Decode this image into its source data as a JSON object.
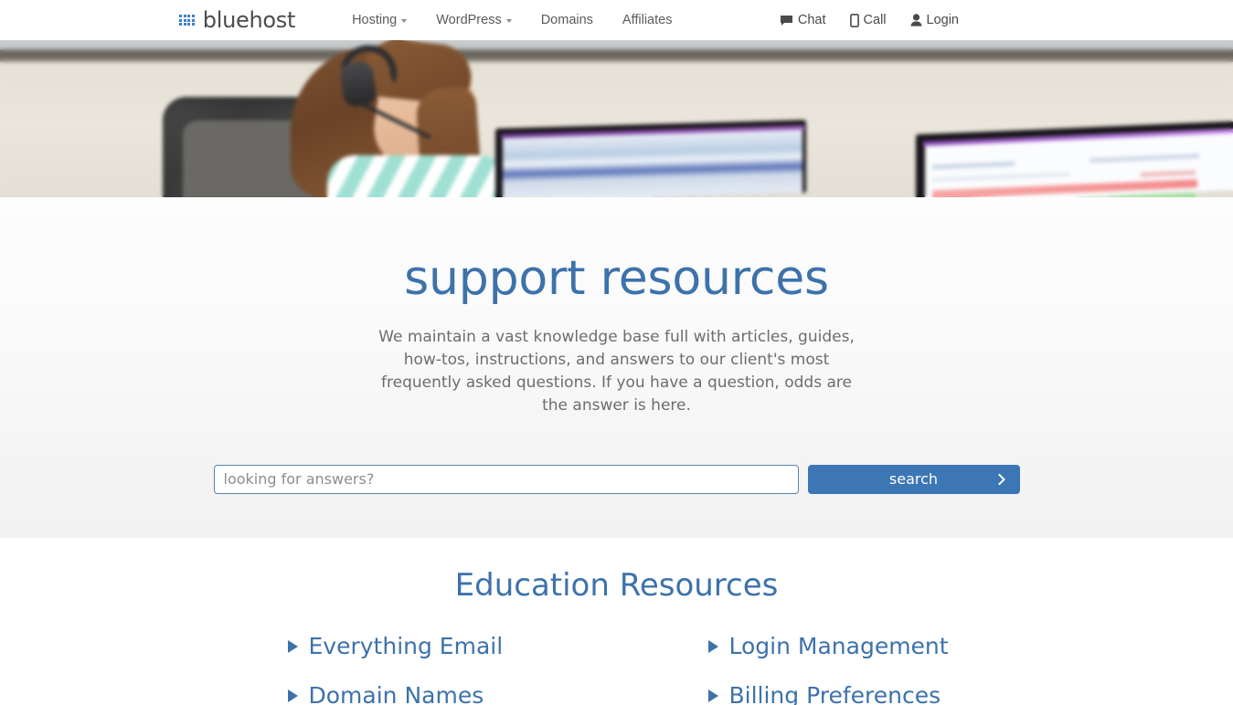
{
  "header": {
    "brand": {
      "name": "bluehost",
      "icon": "grid-icon",
      "color": "#3d7fd0"
    },
    "nav": [
      {
        "label": "Hosting",
        "has_caret": true
      },
      {
        "label": "WordPress",
        "has_caret": true
      },
      {
        "label": "Domains",
        "has_caret": false
      },
      {
        "label": "Affiliates",
        "has_caret": false
      }
    ],
    "utility": [
      {
        "label": "Chat",
        "icon": "chat-bubble-icon"
      },
      {
        "label": "Call",
        "icon": "mobile-phone-icon"
      },
      {
        "label": "Login",
        "icon": "user-icon"
      }
    ]
  },
  "hero": {
    "banner_alt": "support agent wearing headset at desk with two monitors",
    "title": "support resources",
    "description": "We maintain a vast knowledge base full with articles, guides, how-tos, instructions, and answers to our client's most frequently asked questions. If you have a question, odds are the answer is here.",
    "search": {
      "value": "",
      "placeholder": "looking for answers?",
      "button_label": "search",
      "button_icon": "chevron-right-icon",
      "button_color": "#3d76b5"
    }
  },
  "resources": {
    "title": "Education Resources",
    "accent_color": "#3d72ab",
    "items": [
      {
        "label": "Everything Email",
        "bullet": "triangle-right-icon"
      },
      {
        "label": "Login Management",
        "bullet": "triangle-right-icon"
      },
      {
        "label": "Domain Names",
        "bullet": "triangle-right-icon"
      },
      {
        "label": "Billing Preferences",
        "bullet": "triangle-right-icon"
      }
    ]
  }
}
